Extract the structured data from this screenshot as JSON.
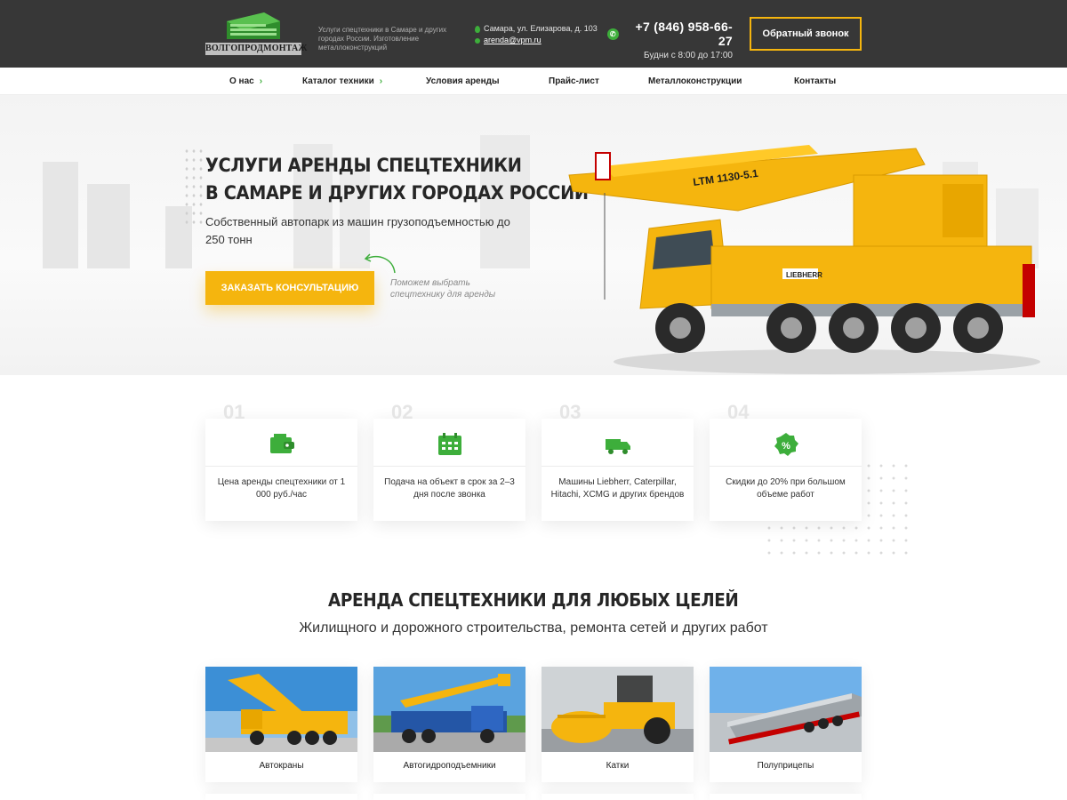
{
  "header": {
    "logo_text": "ВОЛГОПРОДМОНТАЖ",
    "tagline": "Услуги спецтехники в Самаре и других городах России. Изготовление металлоконструкций",
    "address": "Самара, ул. Елизарова, д. 103",
    "email": "arenda@vpm.ru",
    "phone": "+7 (846) 958-66-27",
    "hours": "Будни с 8:00 до 17:00",
    "callback_label": "Обратный звонок",
    "accent_color": "#f5b50e",
    "brand_green": "#3dae3b"
  },
  "nav": {
    "items": [
      {
        "label": "О нас",
        "has_submenu": true
      },
      {
        "label": "Каталог техники",
        "has_submenu": true
      },
      {
        "label": "Условия аренды",
        "has_submenu": false
      },
      {
        "label": "Прайс-лист",
        "has_submenu": false
      },
      {
        "label": "Металлоконструкции",
        "has_submenu": false
      },
      {
        "label": "Контакты",
        "has_submenu": false
      }
    ]
  },
  "hero": {
    "title_line1": "УСЛУГИ АРЕНДЫ СПЕЦТЕХНИКИ",
    "title_line2": "В САМАРЕ И ДРУГИХ ГОРОДАХ РОССИИ",
    "subtitle": "Собственный автопарк из машин грузоподъемностью до 250 тонн",
    "cta_label": "ЗАКАЗАТЬ КОНСУЛЬТАЦИЮ",
    "hint_line1": "Поможем выбрать",
    "hint_line2": "спецтехнику для аренды",
    "crane_boom_text": "LTM 1130-5.1",
    "crane_brand_text": "LIEBHERR"
  },
  "features": [
    {
      "number": "01",
      "icon": "wallet-icon",
      "text": "Цена аренды спецтехники от 1 000 руб./час"
    },
    {
      "number": "02",
      "icon": "calendar-icon",
      "text": "Подача на объект в срок за 2–3 дня после звонка"
    },
    {
      "number": "03",
      "icon": "truck-icon",
      "text": "Машины Liebherr, Caterpillar, Hitachi, XCMG и других брендов"
    },
    {
      "number": "04",
      "icon": "percent-badge-icon",
      "text": "Скидки до 20% при большом объеме работ"
    }
  ],
  "section": {
    "title": "АРЕНДА СПЕЦТЕХНИКИ ДЛЯ ЛЮБЫХ ЦЕЛЕЙ",
    "subtitle": "Жилищного и дорожного строительства, ремонта сетей и других работ",
    "cards": [
      {
        "label": "Автокраны",
        "image": "mobile-crane-photo"
      },
      {
        "label": "Автогидроподъемники",
        "image": "aerial-lift-truck-photo"
      },
      {
        "label": "Катки",
        "image": "road-roller-photo"
      },
      {
        "label": "Полуприцепы",
        "image": "semi-trailer-photo"
      }
    ]
  }
}
